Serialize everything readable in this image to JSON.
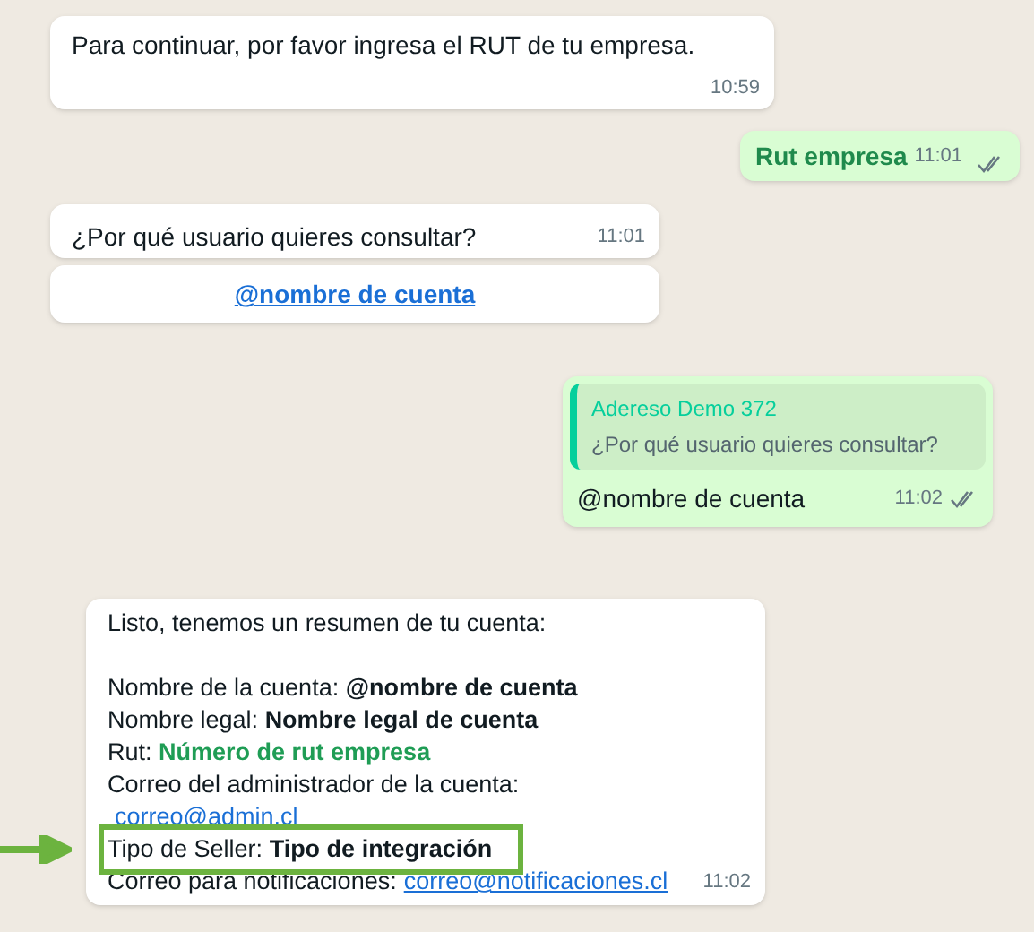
{
  "messages": [
    {
      "kind": "incoming",
      "text": "Para continuar, por favor ingresa el RUT de tu empresa.",
      "time": "10:59"
    },
    {
      "kind": "outgoing",
      "text": "Rut empresa",
      "time": "11:01"
    },
    {
      "kind": "incoming",
      "text": "¿Por qué usuario quieres consultar?",
      "time": "11:01",
      "button": "@nombre de cuenta"
    },
    {
      "kind": "reply",
      "quote_author": "Adereso Demo 372",
      "quote_text": "¿Por qué usuario quieres consultar?",
      "text": "@nombre de cuenta",
      "time": "11:02"
    },
    {
      "kind": "summary",
      "intro": "Listo, tenemos un resumen de tu cuenta:",
      "time": "11:02",
      "lines": [
        {
          "kind": "bold",
          "label": "Nombre de la cuenta:",
          "value": "@nombre de cuenta",
          "highlighted": false
        },
        {
          "kind": "bold",
          "label": "Nombre legal:",
          "value": "Nombre legal de cuenta",
          "highlighted": false
        },
        {
          "kind": "green",
          "label": "Rut:",
          "value": "Número de rut empresa",
          "highlighted": false
        },
        {
          "kind": "plain",
          "label": "Correo del administrador de la cuenta:",
          "highlighted": false
        },
        {
          "kind": "link",
          "value": "correo@admin.cl",
          "highlighted": false
        },
        {
          "kind": "bold",
          "label": "Tipo de Seller:",
          "value": "Tipo de integración",
          "highlighted": true
        },
        {
          "kind": "link",
          "label": "Correo para notificaciones:",
          "value": "correo@notificaciones.cl",
          "highlighted": false
        }
      ]
    }
  ]
}
